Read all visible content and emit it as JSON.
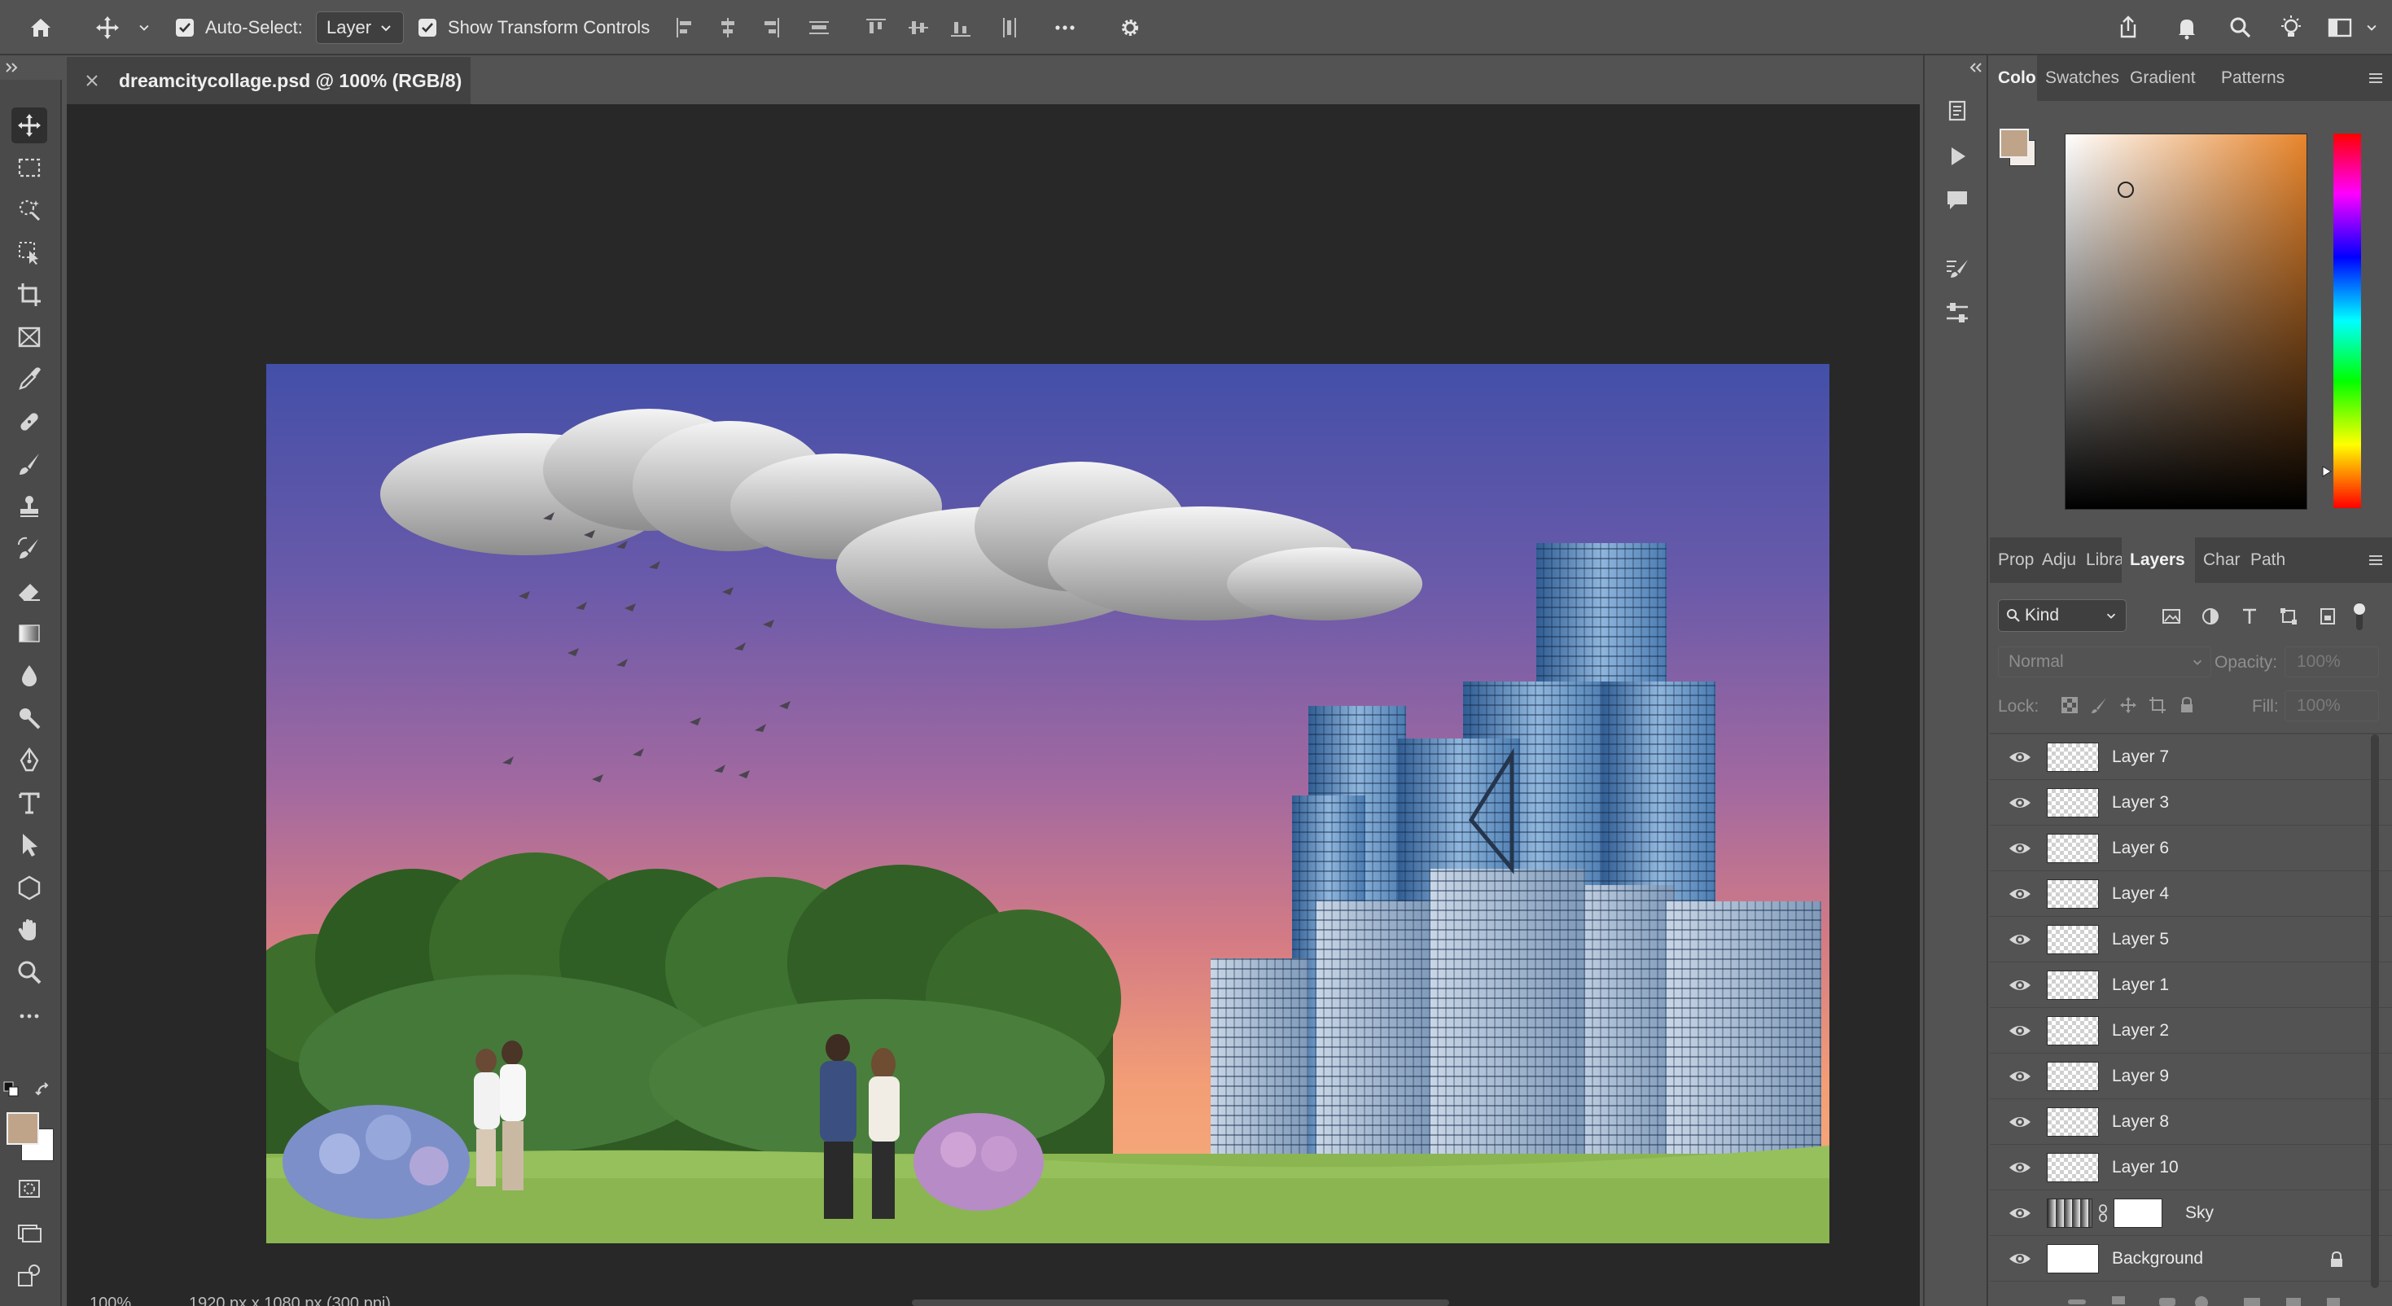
{
  "options_bar": {
    "auto_select_label": "Auto-Select:",
    "auto_select_value": "Layer",
    "show_transform_label": "Show Transform Controls"
  },
  "document": {
    "tab_title": "dreamcitycollage.psd @ 100% (RGB/8)"
  },
  "status_bar": {
    "zoom": "100%",
    "doc_info": "1920 px x 1080 px (300 ppi)"
  },
  "color_panel": {
    "tabs": [
      "Color",
      "Swatches",
      "Gradient",
      "Patterns"
    ],
    "foreground": "#bfa48a",
    "background": "#f3ece6",
    "hue_color": "#e8852b"
  },
  "layers_panel": {
    "tabs": [
      "Prop",
      "Adju",
      "Libra",
      "Layers",
      "Char",
      "Path"
    ],
    "filter_kind": "Kind",
    "blend_mode": "Normal",
    "opacity_label": "Opacity:",
    "opacity_value": "100%",
    "lock_label": "Lock:",
    "fill_label": "Fill:",
    "fill_value": "100%",
    "layers": [
      {
        "name": "Layer 7"
      },
      {
        "name": "Layer 3"
      },
      {
        "name": "Layer 6"
      },
      {
        "name": "Layer 4"
      },
      {
        "name": "Layer 5"
      },
      {
        "name": "Layer 1"
      },
      {
        "name": "Layer 2"
      },
      {
        "name": "Layer 9"
      },
      {
        "name": "Layer 8"
      },
      {
        "name": "Layer 10"
      },
      {
        "name": "Sky"
      },
      {
        "name": "Background"
      }
    ]
  }
}
